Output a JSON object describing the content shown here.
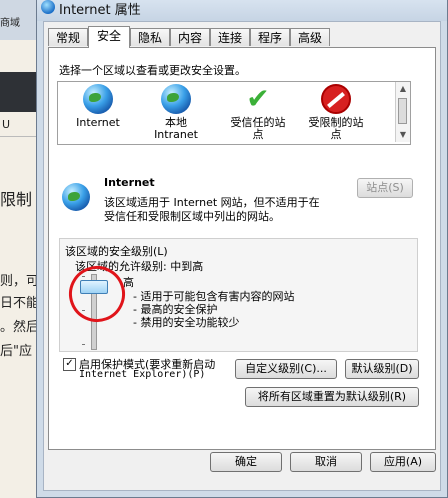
{
  "background": {
    "lines": [
      "商域",
      "限制",
      "则，可",
      "日不能",
      "。然后",
      "后\"应"
    ],
    "toolbar_char": "U"
  },
  "dialog": {
    "title": "Internet 属性",
    "tabs": [
      "常规",
      "安全",
      "隐私",
      "内容",
      "连接",
      "程序",
      "高级"
    ],
    "active_tab": "安全",
    "instruction": "选择一个区域以查看或更改安全设置。",
    "zones": [
      {
        "name": "Internet",
        "icon": "globe-icon"
      },
      {
        "name": "本地\nIntranet",
        "icon": "intranet-icon"
      },
      {
        "name": "受信任的站\n点",
        "icon": "checkmark-icon"
      },
      {
        "name": "受限制的站\n点",
        "icon": "no-entry-icon"
      }
    ],
    "zone_title": "Internet",
    "zone_desc_1": "该区域适用于 Internet 网站，但不适用于在",
    "zone_desc_2": "受信任和受限制区域中列出的网站。",
    "sites_button": "站点(S)",
    "security_level_label": "该区域的安全级别(L)",
    "allowed_levels": "该区域的允许级别: 中到高",
    "level_name": "高",
    "level_points": [
      "- 适用于可能包含有害内容的网站",
      "- 最高的安全保护",
      "- 禁用的安全功能较少"
    ],
    "protected_mode_label": "启用保护模式(要求重新启动",
    "protected_mode_label_2": "Internet Explorer)(P)",
    "protected_mode_checked": "✓",
    "custom_level_button": "自定义级别(C)...",
    "default_level_button": "默认级别(D)",
    "reset_all_button": "将所有区域重置为默认级别(R)",
    "ok_button": "确定",
    "cancel_button": "取消",
    "apply_button": "应用(A)"
  },
  "colors": {
    "annotation": "#e0141a",
    "checkmark": "#3bb038",
    "restricted": "#d72020"
  }
}
